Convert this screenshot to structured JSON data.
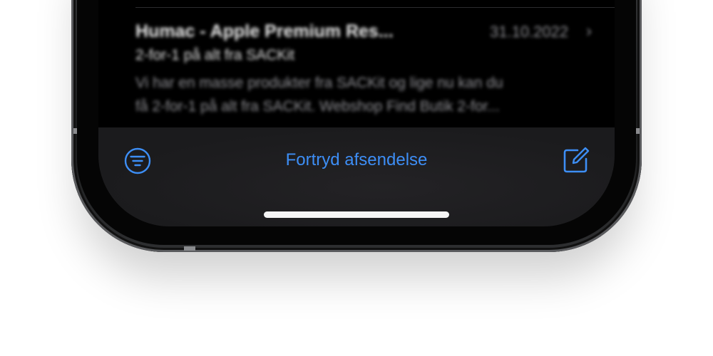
{
  "mail": {
    "sender": "Humac - Apple Premium Res...",
    "date": "31.10.2022",
    "subject": "2-for-1 på alt fra SACKit",
    "preview_line1": "Vi har en masse produkter fra SACKit og lige nu kan du",
    "preview_line2": "få 2-for-1 på alt fra SACKit. Webshop Find Butik 2-for..."
  },
  "toolbar": {
    "filter_icon": "filter-circle-icon",
    "undo_send_label": "Fortryd afsendelse",
    "compose_icon": "compose-icon"
  },
  "colors": {
    "accent": "#3d8ef5",
    "background": "#000000",
    "toolbar": "#1c1c1e"
  }
}
